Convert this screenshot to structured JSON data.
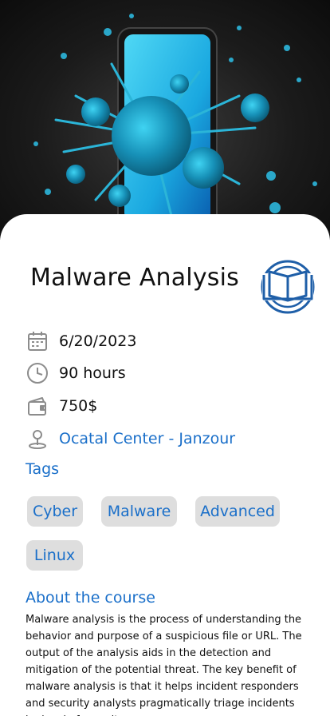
{
  "course": {
    "title": "Malware Analysis",
    "logo_icon": "open-book-icon",
    "date": "6/20/2023",
    "duration": "90 hours",
    "price": "750$",
    "location": "Ocatal Center - Janzour"
  },
  "tags_section": {
    "heading": "Tags",
    "tags": [
      "Cyber",
      "Malware",
      "Advanced",
      "Linux"
    ]
  },
  "about_section": {
    "heading": "About the course",
    "text": "Malware analysis is the process of understanding the behavior and purpose of a suspicious file or URL. The output of the analysis aids in the detection and mitigation of the potential threat. The key benefit of malware analysis is that it helps incident responders and security analysts pragmatically triage incidents by level of severity"
  },
  "icons": {
    "date": "calendar-icon",
    "duration": "clock-icon",
    "price": "wallet-icon",
    "location": "map-pin-icon"
  },
  "colors": {
    "accent": "#1a6fc9",
    "tag_background": "#dedede",
    "icon_gray": "#8c8c8c",
    "logo_blue": "#1f5fa8"
  }
}
